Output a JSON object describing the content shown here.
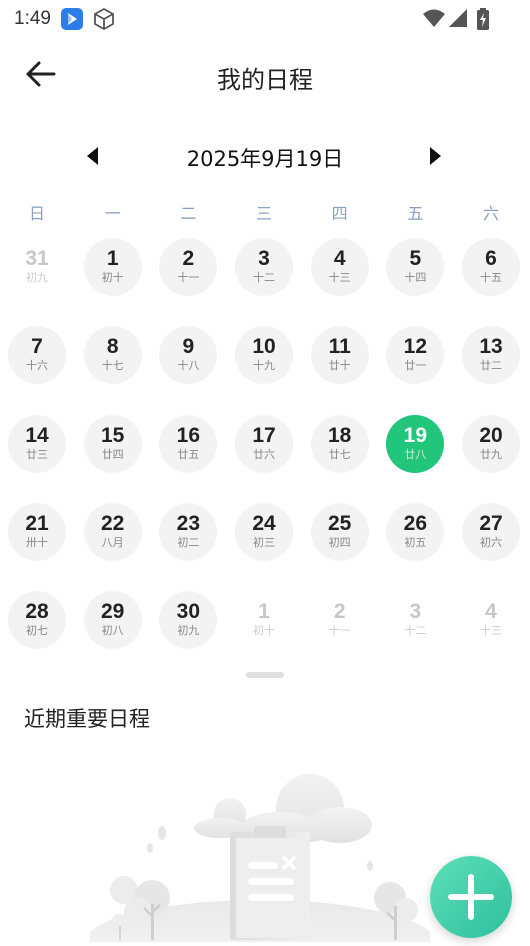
{
  "status_bar": {
    "time": "1:49",
    "icons": [
      "app-notification-icon",
      "package-icon",
      "wifi-icon",
      "cellular-signal-icon",
      "battery-charging-icon"
    ]
  },
  "header": {
    "title": "我的日程"
  },
  "calendar": {
    "current_date_label": "2025年9月19日",
    "weekdays": [
      "日",
      "一",
      "二",
      "三",
      "四",
      "五",
      "六"
    ],
    "accent_color": "#22c67a",
    "weeks": [
      [
        {
          "day": "31",
          "lunar": "初九",
          "other": true
        },
        {
          "day": "1",
          "lunar": "初十"
        },
        {
          "day": "2",
          "lunar": "十一"
        },
        {
          "day": "3",
          "lunar": "十二"
        },
        {
          "day": "4",
          "lunar": "十三"
        },
        {
          "day": "5",
          "lunar": "十四"
        },
        {
          "day": "6",
          "lunar": "十五"
        }
      ],
      [
        {
          "day": "7",
          "lunar": "十六"
        },
        {
          "day": "8",
          "lunar": "十七"
        },
        {
          "day": "9",
          "lunar": "十八"
        },
        {
          "day": "10",
          "lunar": "十九"
        },
        {
          "day": "11",
          "lunar": "廿十"
        },
        {
          "day": "12",
          "lunar": "廿一"
        },
        {
          "day": "13",
          "lunar": "廿二"
        }
      ],
      [
        {
          "day": "14",
          "lunar": "廿三"
        },
        {
          "day": "15",
          "lunar": "廿四"
        },
        {
          "day": "16",
          "lunar": "廿五"
        },
        {
          "day": "17",
          "lunar": "廿六"
        },
        {
          "day": "18",
          "lunar": "廿七"
        },
        {
          "day": "19",
          "lunar": "廿八",
          "selected": true
        },
        {
          "day": "20",
          "lunar": "廿九"
        }
      ],
      [
        {
          "day": "21",
          "lunar": "卅十"
        },
        {
          "day": "22",
          "lunar": "八月"
        },
        {
          "day": "23",
          "lunar": "初二"
        },
        {
          "day": "24",
          "lunar": "初三"
        },
        {
          "day": "25",
          "lunar": "初四"
        },
        {
          "day": "26",
          "lunar": "初五"
        },
        {
          "day": "27",
          "lunar": "初六"
        }
      ],
      [
        {
          "day": "28",
          "lunar": "初七"
        },
        {
          "day": "29",
          "lunar": "初八"
        },
        {
          "day": "30",
          "lunar": "初九"
        },
        {
          "day": "1",
          "lunar": "初十",
          "other": true
        },
        {
          "day": "2",
          "lunar": "十一",
          "other": true
        },
        {
          "day": "3",
          "lunar": "十二",
          "other": true
        },
        {
          "day": "4",
          "lunar": "十三",
          "other": true
        }
      ]
    ]
  },
  "schedule": {
    "section_title": "近期重要日程"
  },
  "fab": {
    "icon": "plus-icon"
  }
}
